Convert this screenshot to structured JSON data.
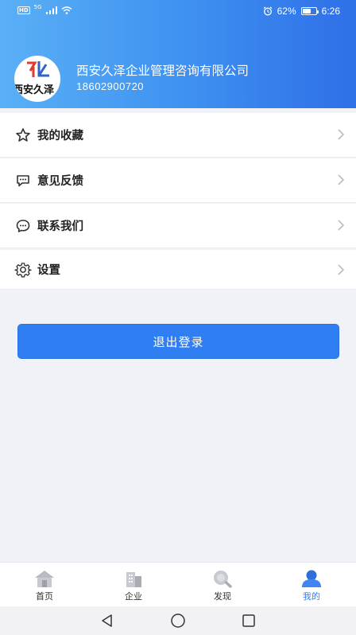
{
  "status_bar": {
    "hd": "HD",
    "network": "5G",
    "battery_percent": "62%",
    "battery_level": 0.62,
    "time": "6:26"
  },
  "profile": {
    "logo_text": "西安久泽",
    "company_name": "西安久泽企业管理咨询有限公司",
    "phone": "18602900720"
  },
  "menu": {
    "items": [
      {
        "label": "我的收藏",
        "icon": "star-icon"
      },
      {
        "label": "意见反馈",
        "icon": "feedback-icon"
      },
      {
        "label": "联系我们",
        "icon": "contact-icon"
      },
      {
        "label": "设置",
        "icon": "gear-icon"
      }
    ]
  },
  "logout_label": "退出登录",
  "tabbar": {
    "items": [
      {
        "label": "首页",
        "icon": "home-icon"
      },
      {
        "label": "企业",
        "icon": "building-icon"
      },
      {
        "label": "发现",
        "icon": "discover-icon"
      },
      {
        "label": "我的",
        "icon": "user-icon",
        "active": true
      }
    ]
  },
  "colors": {
    "primary": "#2f7ef2",
    "header_start": "#5ab0f6",
    "header_end": "#2f6fe8",
    "background": "#f0f2f8"
  }
}
